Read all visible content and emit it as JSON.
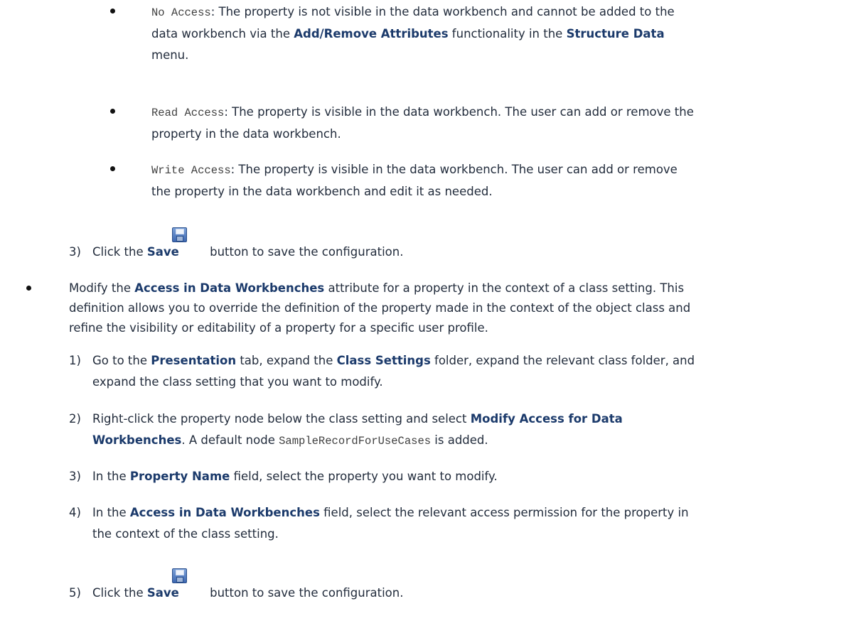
{
  "sub_bullets": [
    {
      "code": "No Access",
      "text_before": ": The property is not visible in the data workbench and cannot be added to the data workbench via the ",
      "bold1": "Add/Remove Attributes",
      "text_mid": " functionality in the ",
      "bold2": "Structure Data",
      "text_after": " menu."
    },
    {
      "code": "Read Access",
      "text": ": The property is visible in the data workbench. The user can add or remove the property in the data workbench."
    },
    {
      "code": "Write Access",
      "text": ": The property is visible in the data workbench. The user can add or remove the property in the data workbench and edit it as needed."
    }
  ],
  "step3_top": {
    "number": "3)",
    "prefix": "Click the ",
    "bold": "Save",
    "suffix": " button to save the configuration."
  },
  "main_bullet": {
    "prefix": "Modify the ",
    "bold": "Access in Data Workbenches",
    "suffix": " attribute for a property in the context of a class setting. This definition allows you to override the definition of the property made in the context of the object class and refine the visibility or editability of a property for a specific user profile."
  },
  "steps": [
    {
      "number": "1)",
      "t1": "Go to the ",
      "b1": "Presentation",
      "t2": " tab, expand the ",
      "b2": "Class Settings",
      "t3": " folder, expand the relevant class folder, and expand the class setting that you want to modify."
    },
    {
      "number": "2)",
      "t1": "Right-click the property node below the class setting and select ",
      "b1": "Modify Access for Data Workbenches",
      "t2": ". A default node ",
      "code": "SampleRecordForUseCases",
      "t3": " is added."
    },
    {
      "number": "3)",
      "t1": "In the ",
      "b1": "Property Name",
      "t2": " field, select the property you want to modify."
    },
    {
      "number": "4)",
      "t1": "In the ",
      "b1": "Access in Data Workbenches",
      "t2": " field, select the relevant access permission for the property in the context of the class setting."
    },
    {
      "number": "5)",
      "t1": "Click the ",
      "b1": "Save",
      "t2": " button to save the configuration."
    }
  ],
  "icons": {
    "save": "save-icon"
  }
}
